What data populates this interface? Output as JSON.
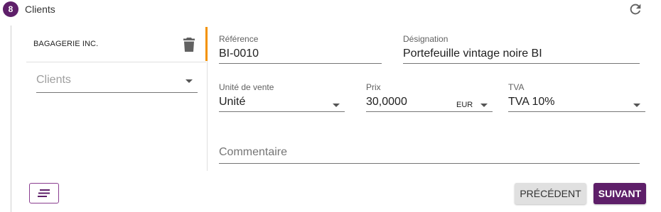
{
  "step": {
    "number": "8",
    "title": "Clients"
  },
  "icons": {
    "refresh": "refresh-icon",
    "trash": "trash-icon",
    "list": "list-icon"
  },
  "left": {
    "client_name": "BAGAGERIE INC.",
    "clients_placeholder": "Clients"
  },
  "form": {
    "reference": {
      "label": "Référence",
      "value": "BI-0010"
    },
    "designation": {
      "label": "Désignation",
      "value": "Portefeuille vintage noire BI"
    },
    "unite": {
      "label": "Unité de vente",
      "value": "Unité"
    },
    "prix": {
      "label": "Prix",
      "value": "30,0000",
      "currency": "EUR"
    },
    "tva": {
      "label": "TVA",
      "value": "TVA 10%"
    },
    "commentaire": {
      "placeholder": "Commentaire"
    }
  },
  "buttons": {
    "previous": "PRÉCÉDENT",
    "next": "SUIVANT"
  },
  "colors": {
    "primary": "#5e1f69",
    "accent": "#f39200"
  }
}
